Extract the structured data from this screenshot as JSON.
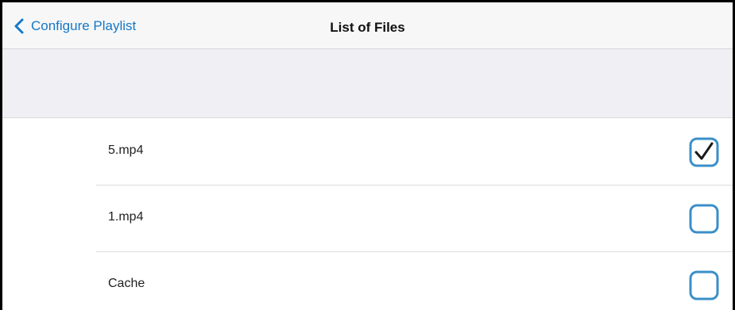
{
  "navbar": {
    "back_label": "Configure Playlist",
    "title": "List of Files"
  },
  "files": [
    {
      "name": "5.mp4",
      "checked": true
    },
    {
      "name": "1.mp4",
      "checked": false
    },
    {
      "name": "Cache",
      "checked": false
    }
  ],
  "colors": {
    "accent": "#1478c8",
    "checkbox_border": "#3a8fc8",
    "navbar_bg": "#f7f7f7",
    "section_bg": "#efeff4"
  },
  "icons": {
    "back": "chevron-left-icon",
    "checked": "checkbox-checked-icon",
    "unchecked": "checkbox-unchecked-icon"
  }
}
